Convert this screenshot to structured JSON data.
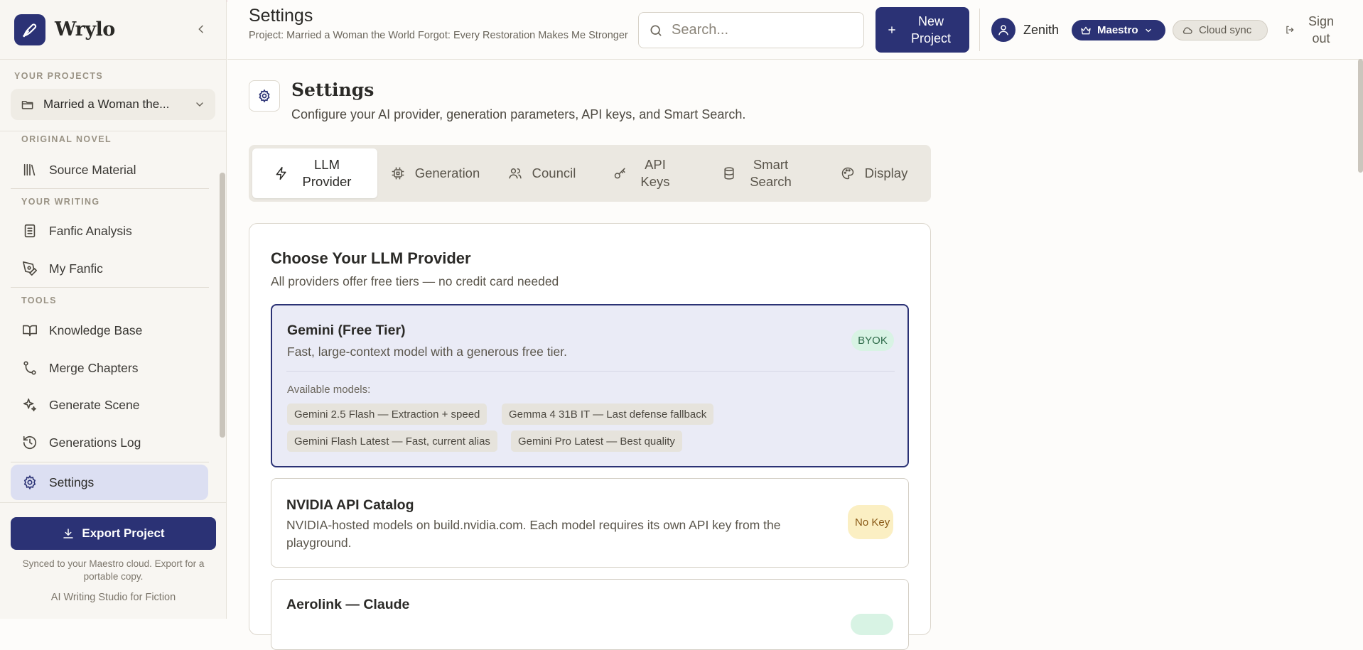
{
  "app": {
    "name": "Wrylo"
  },
  "sidebar": {
    "projects_label": "YOUR PROJECTS",
    "current_project": "Married a Woman the...",
    "sections": {
      "original": "ORIGINAL NOVEL",
      "writing": "YOUR WRITING",
      "tools": "TOOLS"
    },
    "items": {
      "source": "Source Material",
      "analysis": "Fanfic Analysis",
      "myfanfic": "My Fanfic",
      "kb": "Knowledge Base",
      "merge": "Merge Chapters",
      "scene": "Generate Scene",
      "log": "Generations Log",
      "settings": "Settings"
    },
    "active_item": "Settings",
    "export_label": "Export Project",
    "sync_note": "Synced to your Maestro cloud. Export for a portable copy.",
    "tagline": "AI Writing Studio for Fiction"
  },
  "header": {
    "title": "Settings",
    "project_line": "Project: Married a Woman the World Forgot: Every Restoration Makes Me Stronger",
    "search_placeholder": "Search...",
    "new_project_label": "New Project",
    "user_name": "Zenith",
    "tier": "Maestro",
    "cloud": "Cloud sync",
    "signout": "Sign out"
  },
  "page": {
    "title": "Settings",
    "subtitle": "Configure your AI provider, generation parameters, API keys, and Smart Search."
  },
  "tabs": {
    "llm": "LLM Provider",
    "gen": "Generation",
    "council": "Council",
    "api": "API Keys",
    "smart": "Smart Search",
    "display": "Display"
  },
  "active_tab": "LLM Provider",
  "provider_section": {
    "title": "Choose Your LLM Provider",
    "subtitle": "All providers offer free tiers — no credit card needed",
    "models_label": "Available models:",
    "providers": [
      {
        "name": "Gemini (Free Tier)",
        "desc": "Fast, large-context model with a generous free tier.",
        "badge": "BYOK",
        "selected": true,
        "models": [
          "Gemini 2.5 Flash — Extraction + speed",
          "Gemma 4 31B IT — Last defense fallback",
          "Gemini Flash Latest — Fast, current alias",
          "Gemini Pro Latest — Best quality"
        ]
      },
      {
        "name": "NVIDIA API Catalog",
        "desc": "NVIDIA-hosted models on build.nvidia.com. Each model requires its own API key from the playground.",
        "badge": "No Key",
        "selected": false
      },
      {
        "name": "Aerolink — Claude",
        "selected": false
      }
    ]
  },
  "colors": {
    "brand": "#2b3275",
    "active_nav": "#dcdff2",
    "byok_badge": "#d8f3e4",
    "nokey_badge": "#fbefc3"
  }
}
